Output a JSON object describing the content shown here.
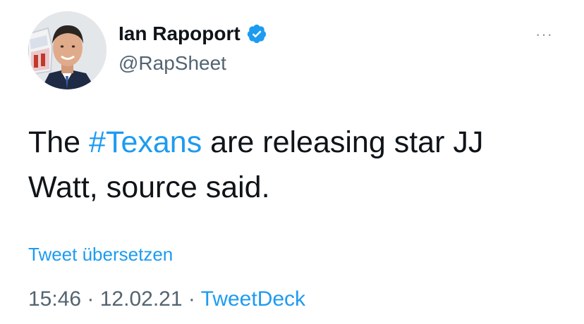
{
  "author": {
    "display_name": "Ian Rapoport",
    "handle": "@RapSheet",
    "verified": true
  },
  "tweet": {
    "text_before": "The ",
    "hashtag": "#Texans",
    "text_after": " are releasing star JJ Watt, source said."
  },
  "translate_link": "Tweet übersetzen",
  "meta": {
    "time": "15:46",
    "separator": " · ",
    "date": "12.02.21",
    "source": "TweetDeck"
  },
  "menu": {
    "label": "···"
  },
  "colors": {
    "link": "#1d9bf0",
    "text": "#0f1419",
    "secondary": "#536471"
  }
}
